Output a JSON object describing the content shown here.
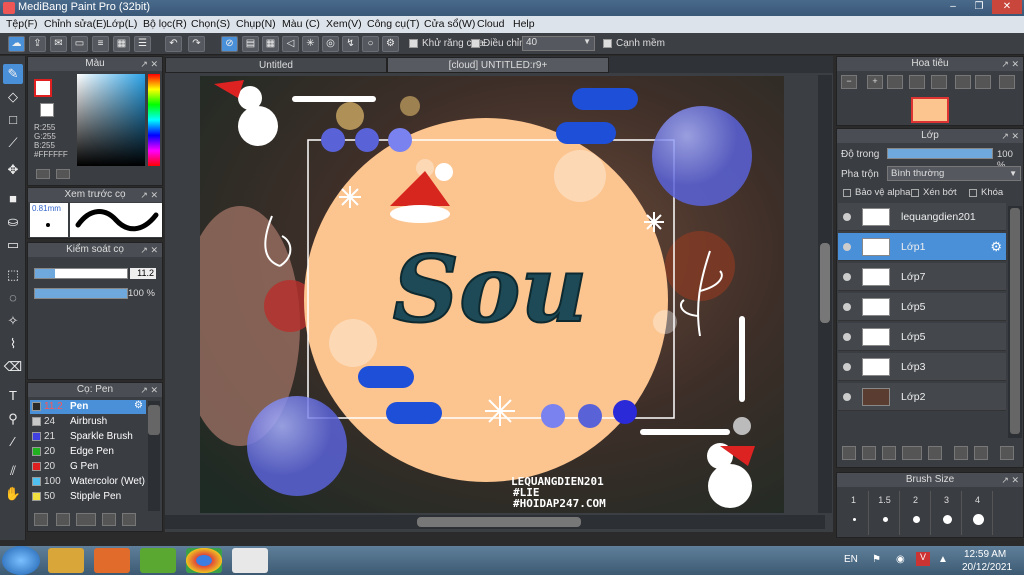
{
  "window": {
    "title": "MediBang Paint Pro (32bit)",
    "controls": [
      "–",
      "❐",
      "✕"
    ]
  },
  "menu": [
    "Tệp(F)",
    "Chỉnh sửa(E)",
    "Lớp(L)",
    "Bộ lọc(R)",
    "Chọn(S)",
    "Chụp(N)",
    "Màu (C)",
    "Xem(V)",
    "Công cụ(T)",
    "Cửa sổ(W)",
    "Cloud",
    "Help"
  ],
  "toolbar": {
    "antialias_label": "Khử răng cưa",
    "correction_label": "Điều chỉnh",
    "correction_value": "40",
    "snap_label": "Cạnh mềm"
  },
  "color_panel": {
    "title": "Màu",
    "r": "R:255",
    "g": "G:255",
    "b": "B:255",
    "hex": "#FFFFFF",
    "primary_color": "#e02020",
    "secondary_color": "#ffffff"
  },
  "brush_preview": {
    "title": "Xem trước cọ",
    "size": "0.81mm"
  },
  "brush_control": {
    "title": "Kiểm soát cọ",
    "size_value": "11.2",
    "opacity_value": "100 %"
  },
  "brush_list": {
    "title": "Cọ: Pen",
    "items": [
      {
        "size": "11.2",
        "name": "Pen",
        "color": "#2a2a2a"
      },
      {
        "size": "24",
        "name": "Airbrush",
        "color": "#c8c8c8"
      },
      {
        "size": "21",
        "name": "Sparkle Brush",
        "color": "#4040e0"
      },
      {
        "size": "20",
        "name": "Edge Pen",
        "color": "#20b020"
      },
      {
        "size": "20",
        "name": "G Pen",
        "color": "#e02020"
      },
      {
        "size": "100",
        "name": "Watercolor (Wet)",
        "color": "#50c0f0"
      },
      {
        "size": "50",
        "name": "Stipple Pen",
        "color": "#f0e040"
      }
    ]
  },
  "tabs": [
    {
      "label": "Untitled"
    },
    {
      "label": "[cloud] UNTITLED:r9+"
    }
  ],
  "artwork": {
    "title_text": "Sou",
    "credit_1": "LEQUANGDIEN201",
    "credit_2": "#LIE",
    "credit_3": "#HOIDAP247.COM"
  },
  "navigator": {
    "title": "Hoa tiêu"
  },
  "layer_panel": {
    "title": "Lớp",
    "opacity_label": "Độ trong",
    "opacity_value": "100 %",
    "blend_label": "Pha trộn",
    "blend_value": "Bình thường",
    "protect_alpha": "Bảo vệ alpha",
    "clipping": "Xén bớt",
    "lock": "Khóa",
    "layers": [
      {
        "name": "lequangdien201",
        "selected": false
      },
      {
        "name": "Lớp1",
        "selected": true
      },
      {
        "name": "Lớp7",
        "selected": false
      },
      {
        "name": "Lớp5",
        "selected": false
      },
      {
        "name": "Lớp5",
        "selected": false
      },
      {
        "name": "Lớp3",
        "selected": false
      },
      {
        "name": "Lớp2",
        "selected": false
      }
    ]
  },
  "brush_size": {
    "title": "Brush Size",
    "sizes": [
      "1",
      "1.5",
      "2",
      "3",
      "4"
    ]
  },
  "taskbar": {
    "lang": "EN",
    "time": "12:59 AM",
    "date": "20/12/2021"
  }
}
